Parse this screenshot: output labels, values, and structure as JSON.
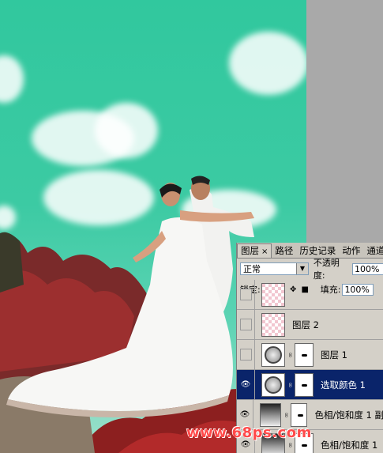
{
  "panel": {
    "tabs": [
      {
        "label": "图层",
        "active": true,
        "close": "×"
      },
      {
        "label": "路径",
        "active": false
      },
      {
        "label": "历史记录",
        "active": false
      },
      {
        "label": "动作",
        "active": false
      },
      {
        "label": "通道",
        "active": false
      }
    ],
    "blend_mode": "正常",
    "opacity_label": "不透明度:",
    "opacity_value": "100%",
    "lock_label": "锁定:",
    "fill_label": "填充:",
    "fill_value": "100%"
  },
  "layers": [
    {
      "name": "",
      "visible": false,
      "thumb": "transparent",
      "selected": false,
      "has_mask": false
    },
    {
      "name": "图层 2",
      "visible": false,
      "thumb": "transparent",
      "selected": false,
      "has_mask": false
    },
    {
      "name": "图层 1",
      "visible": false,
      "thumb": "adjust",
      "selected": false,
      "has_mask": true
    },
    {
      "name": "选取颜色 1",
      "visible": true,
      "thumb": "adjust",
      "selected": true,
      "has_mask": true
    },
    {
      "name": "色相/饱和度 1 副",
      "visible": true,
      "thumb": "huesat",
      "selected": false,
      "has_mask": true
    },
    {
      "name": "色相/饱和度 1",
      "visible": true,
      "thumb": "huesat",
      "selected": false,
      "has_mask": true
    }
  ],
  "watermark": "www.68ps.com",
  "colors": {
    "sky": "#31c89e",
    "selection": "#0a246a",
    "panel_bg": "#d4d0c8",
    "watermark": "#ff4a4a"
  }
}
